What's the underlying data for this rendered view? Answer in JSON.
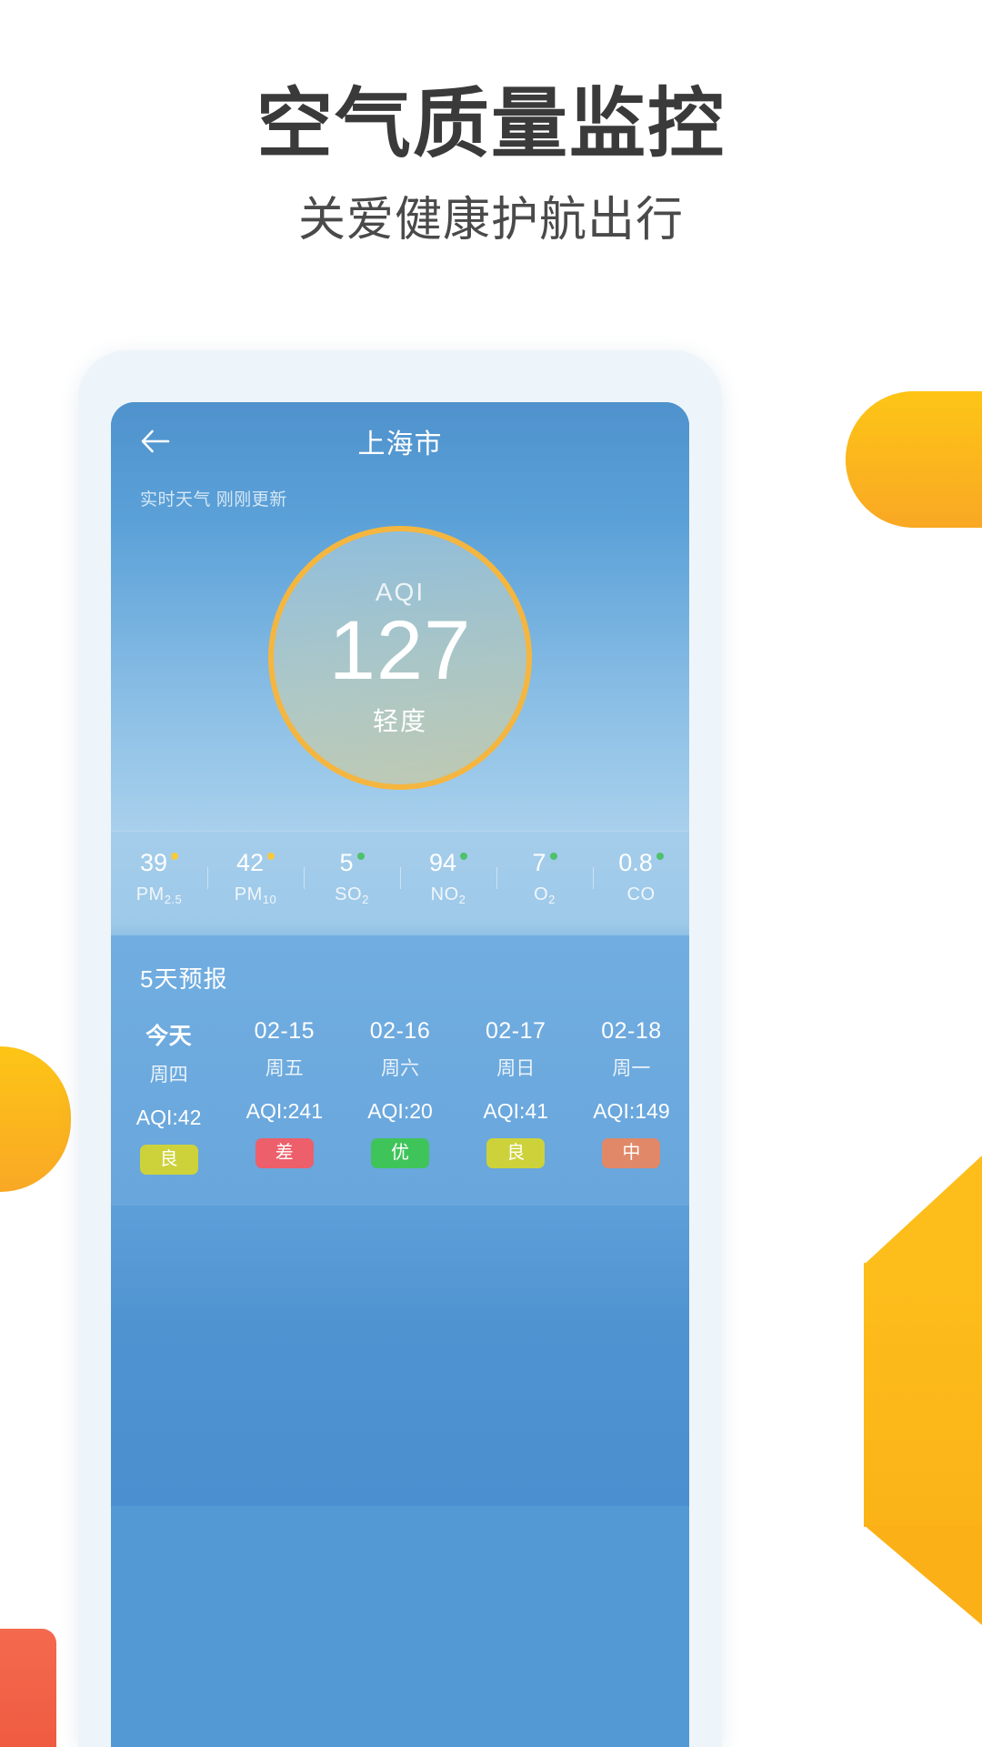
{
  "headline": {
    "title": "空气质量监控",
    "subtitle": "关爱健康护航出行"
  },
  "app": {
    "nav": {
      "back_icon": "arrow-left-icon",
      "title": "上海市"
    },
    "update_status": "实时天气 刚刚更新",
    "aqi": {
      "label": "AQI",
      "value": "127",
      "level": "轻度",
      "ring_color": "#f5b63f"
    },
    "pollutants": [
      {
        "value": "39",
        "name": "PM",
        "sub": "2.5",
        "dot_color": "#f7c93f"
      },
      {
        "value": "42",
        "name": "PM",
        "sub": "10",
        "dot_color": "#f7c93f"
      },
      {
        "value": "5",
        "name": "SO",
        "sub": "2",
        "dot_color": "#4ec16a"
      },
      {
        "value": "94",
        "name": "NO",
        "sub": "2",
        "dot_color": "#4ec16a"
      },
      {
        "value": "7",
        "name": "O",
        "sub": "2",
        "dot_color": "#4ec16a"
      },
      {
        "value": "0.8",
        "name": "CO",
        "sub": "",
        "dot_color": "#4ec16a"
      }
    ],
    "forecast": {
      "title": "5天预报",
      "days": [
        {
          "date": "今天",
          "weekday": "周四",
          "aqi": "AQI:42",
          "badge": "良",
          "badge_color": "#cdd23a"
        },
        {
          "date": "02-15",
          "weekday": "周五",
          "aqi": "AQI:241",
          "badge": "差",
          "badge_color": "#ec5f6b"
        },
        {
          "date": "02-16",
          "weekday": "周六",
          "aqi": "AQI:20",
          "badge": "优",
          "badge_color": "#3fc45a"
        },
        {
          "date": "02-17",
          "weekday": "周日",
          "aqi": "AQI:41",
          "badge": "良",
          "badge_color": "#cdd23a"
        },
        {
          "date": "02-18",
          "weekday": "周一",
          "aqi": "AQI:149",
          "badge": "中",
          "badge_color": "#e08868"
        }
      ]
    }
  }
}
